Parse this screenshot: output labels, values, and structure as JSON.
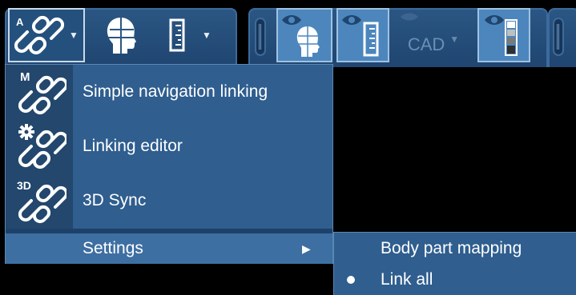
{
  "toolbar": {
    "linking_button": {
      "icon": "chain-link-icon",
      "badge": "A"
    },
    "head_button": {
      "icon": "head-profile-icon"
    },
    "ruler_button": {
      "icon": "ruler-icon"
    },
    "eye_head_toggle": {
      "icon": "eye-head-icon"
    },
    "eye_ruler_toggle": {
      "icon": "eye-ruler-icon"
    },
    "cad_button": {
      "label": "CAD"
    },
    "eye_ramp_toggle": {
      "icon": "eye-grayscale-icon"
    }
  },
  "menu": {
    "items": [
      {
        "label": "Simple navigation linking",
        "icon": "chain-link-icon",
        "badge": "M"
      },
      {
        "label": "Linking editor",
        "icon": "chain-link-icon",
        "badge": "gear"
      },
      {
        "label": "3D Sync",
        "icon": "chain-link-icon",
        "badge": "3D"
      }
    ],
    "settings": {
      "label": "Settings"
    }
  },
  "submenu": {
    "items": [
      {
        "label": "Body part mapping",
        "selected": false
      },
      {
        "label": "Link all",
        "selected": true
      }
    ]
  },
  "colors": {
    "toolbar_bg": "#2b5683",
    "menu_bg": "#2f5e8f",
    "highlight": "#3e6fa2",
    "active_toggle": "#4c86bd"
  }
}
